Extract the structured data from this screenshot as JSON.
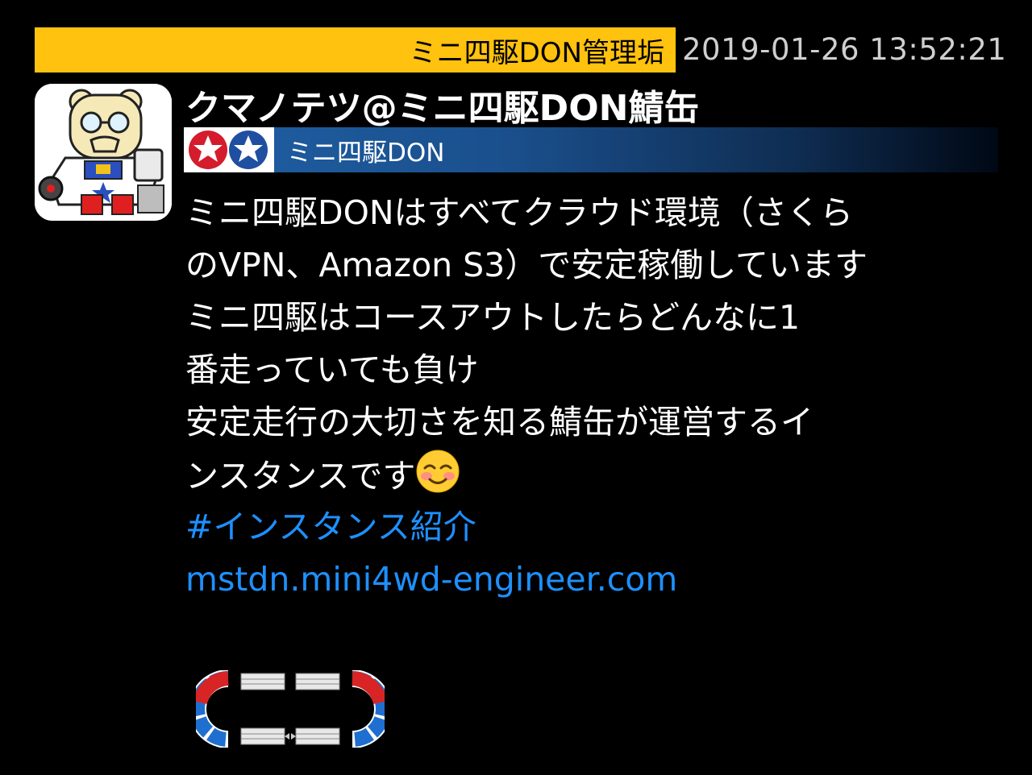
{
  "post": {
    "account_bar_label": "ミニ四駆DON管理垢",
    "timestamp": "2019-01-26 13:52:21",
    "display_name": "クマノテツ@ミニ四駆DON鯖缶",
    "instance": {
      "name": "ミニ四駆DON"
    },
    "content_lines": [
      "ミニ四駆DONはすべてクラウド環境（さくら",
      "のVPN、Amazon S3）で安定稼働しています",
      "ミニ四駆はコースアウトしたらどんなに1",
      "番走っていても負け",
      "安定走行の大切さを知る鯖缶が運営するイ",
      "ンスタンスです"
    ],
    "hashtag": "#インスタンス紹介",
    "link": "mstdn.mini4wd-engineer.com"
  },
  "icons": {
    "avatar": "bear-robot-avatar",
    "instance_icon": "star-logo-icon",
    "emoji": "smiling-blush-emoji",
    "attachment": "race-track-image"
  },
  "colors": {
    "account_bar": "#ffc20e",
    "link": "#1e90ff",
    "ticker_start": "#1f5fa4",
    "background": "#000000"
  }
}
